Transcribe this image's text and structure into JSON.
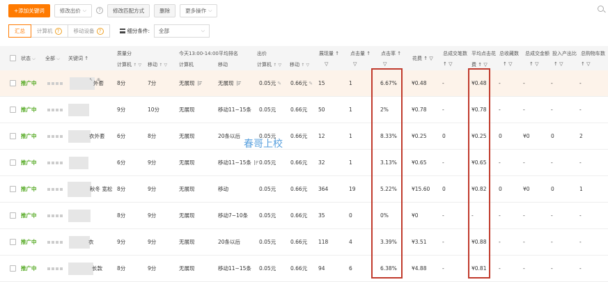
{
  "toolbar": {
    "add_keyword": "+添加关键词",
    "modify_bid": "修改出价",
    "help": "?",
    "modify_match": "修改匹配方式",
    "delete": "删除",
    "more_ops": "更多操作"
  },
  "tabs": {
    "summary": "汇总",
    "computer": "计算机",
    "mobile": "移动设备",
    "filter_label": "细分条件:",
    "filter_value": "全部"
  },
  "header": {
    "status": "状态",
    "all": "全部",
    "keyword": "关键词",
    "quality_score": "质量分",
    "today_rank": "今天13:00-14:00平均排名",
    "bid": "出价",
    "impressions": "展现量",
    "clicks": "点击量",
    "ctr": "点击率",
    "cost": "花费",
    "total_deals": "总成交笔数",
    "avg_cpc_line1": "平均点击花",
    "avg_cpc_line2": "费",
    "total_favorites": "总收藏数",
    "total_deal_amount": "总成交金额",
    "roi": "投入产出比",
    "total_cart": "总购物车数",
    "sub_computer": "计算机",
    "sub_mobile": "移动",
    "sort": "↑",
    "filter": "▽"
  },
  "rows": [
    {
      "status": "推广中",
      "kw": "外套",
      "q_pc": "8分",
      "q_m": "7分",
      "rank_pc": "无展现",
      "rank_m": "无展现",
      "bid_pc": "0.05元",
      "bid_m": "0.66元",
      "imp": "15",
      "clk": "1",
      "ctr": "6.67%",
      "cost": "¥0.48",
      "deals": "-",
      "cpc": "¥0.48",
      "fav": "-",
      "amt": "-",
      "roi": "-",
      "cart": "-"
    },
    {
      "status": "推广中",
      "kw": "",
      "q_pc": "9分",
      "q_m": "10分",
      "rank_pc": "无展现",
      "rank_m": "移动11~15条",
      "bid_pc": "0.05元",
      "bid_m": "0.66元",
      "imp": "50",
      "clk": "1",
      "ctr": "2%",
      "cost": "¥0.78",
      "deals": "-",
      "cpc": "¥0.78",
      "fav": "-",
      "amt": "-",
      "roi": "-",
      "cart": "-"
    },
    {
      "status": "推广中",
      "kw": "衣外套",
      "q_pc": "6分",
      "q_m": "8分",
      "rank_pc": "无展现",
      "rank_m": "20条以后",
      "bid_pc": "0.05元",
      "bid_m": "0.66元",
      "imp": "12",
      "clk": "1",
      "ctr": "8.33%",
      "cost": "¥0.25",
      "deals": "0",
      "cpc": "¥0.25",
      "fav": "0",
      "amt": "¥0",
      "roi": "0",
      "cart": "2"
    },
    {
      "status": "推广中",
      "kw": "",
      "q_pc": "6分",
      "q_m": "9分",
      "rank_pc": "无展现",
      "rank_m": "移动11~15条",
      "bid_pc": "0.05元",
      "bid_m": "0.66元",
      "imp": "32",
      "clk": "1",
      "ctr": "3.13%",
      "cost": "¥0.65",
      "deals": "-",
      "cpc": "¥0.65",
      "fav": "-",
      "amt": "-",
      "roi": "-",
      "cart": "-"
    },
    {
      "status": "推广中",
      "kw": "秋冬 宽松",
      "q_pc": "8分",
      "q_m": "9分",
      "rank_pc": "无展现",
      "rank_m": "移动",
      "bid_pc": "0.05元",
      "bid_m": "0.66元",
      "imp": "364",
      "clk": "19",
      "ctr": "5.22%",
      "cost": "¥15.60",
      "deals": "0",
      "cpc": "¥0.82",
      "fav": "0",
      "amt": "¥0",
      "roi": "0",
      "cart": "1"
    },
    {
      "status": "推广中",
      "kw": "",
      "q_pc": "8分",
      "q_m": "9分",
      "rank_pc": "无展现",
      "rank_m": "移动7~10条",
      "bid_pc": "0.05元",
      "bid_m": "0.66元",
      "imp": "35",
      "clk": "0",
      "ctr": "0%",
      "cost": "¥0",
      "deals": "-",
      "cpc": "-",
      "fav": "-",
      "amt": "-",
      "roi": "-",
      "cart": "-"
    },
    {
      "status": "推广中",
      "kw": "衣",
      "q_pc": "9分",
      "q_m": "9分",
      "rank_pc": "无展现",
      "rank_m": "20条以后",
      "bid_pc": "0.05元",
      "bid_m": "0.66元",
      "imp": "118",
      "clk": "4",
      "ctr": "3.39%",
      "cost": "¥3.51",
      "deals": "-",
      "cpc": "¥0.88",
      "fav": "-",
      "amt": "-",
      "roi": "-",
      "cart": "-"
    },
    {
      "status": "推广中",
      "kw": "长款",
      "q_pc": "8分",
      "q_m": "9分",
      "rank_pc": "无展现",
      "rank_m": "移动11~15条",
      "bid_pc": "0.05元",
      "bid_m": "0.66元",
      "imp": "94",
      "clk": "6",
      "ctr": "6.38%",
      "cost": "¥4.88",
      "deals": "-",
      "cpc": "¥0.81",
      "fav": "-",
      "amt": "-",
      "roi": "-",
      "cart": "-"
    }
  ],
  "watermark": "春哥上校",
  "colors": {
    "accent": "#ff7a00",
    "status": "#52a820",
    "highlight": "#c0392b",
    "watermark": "#3a8fd8"
  }
}
